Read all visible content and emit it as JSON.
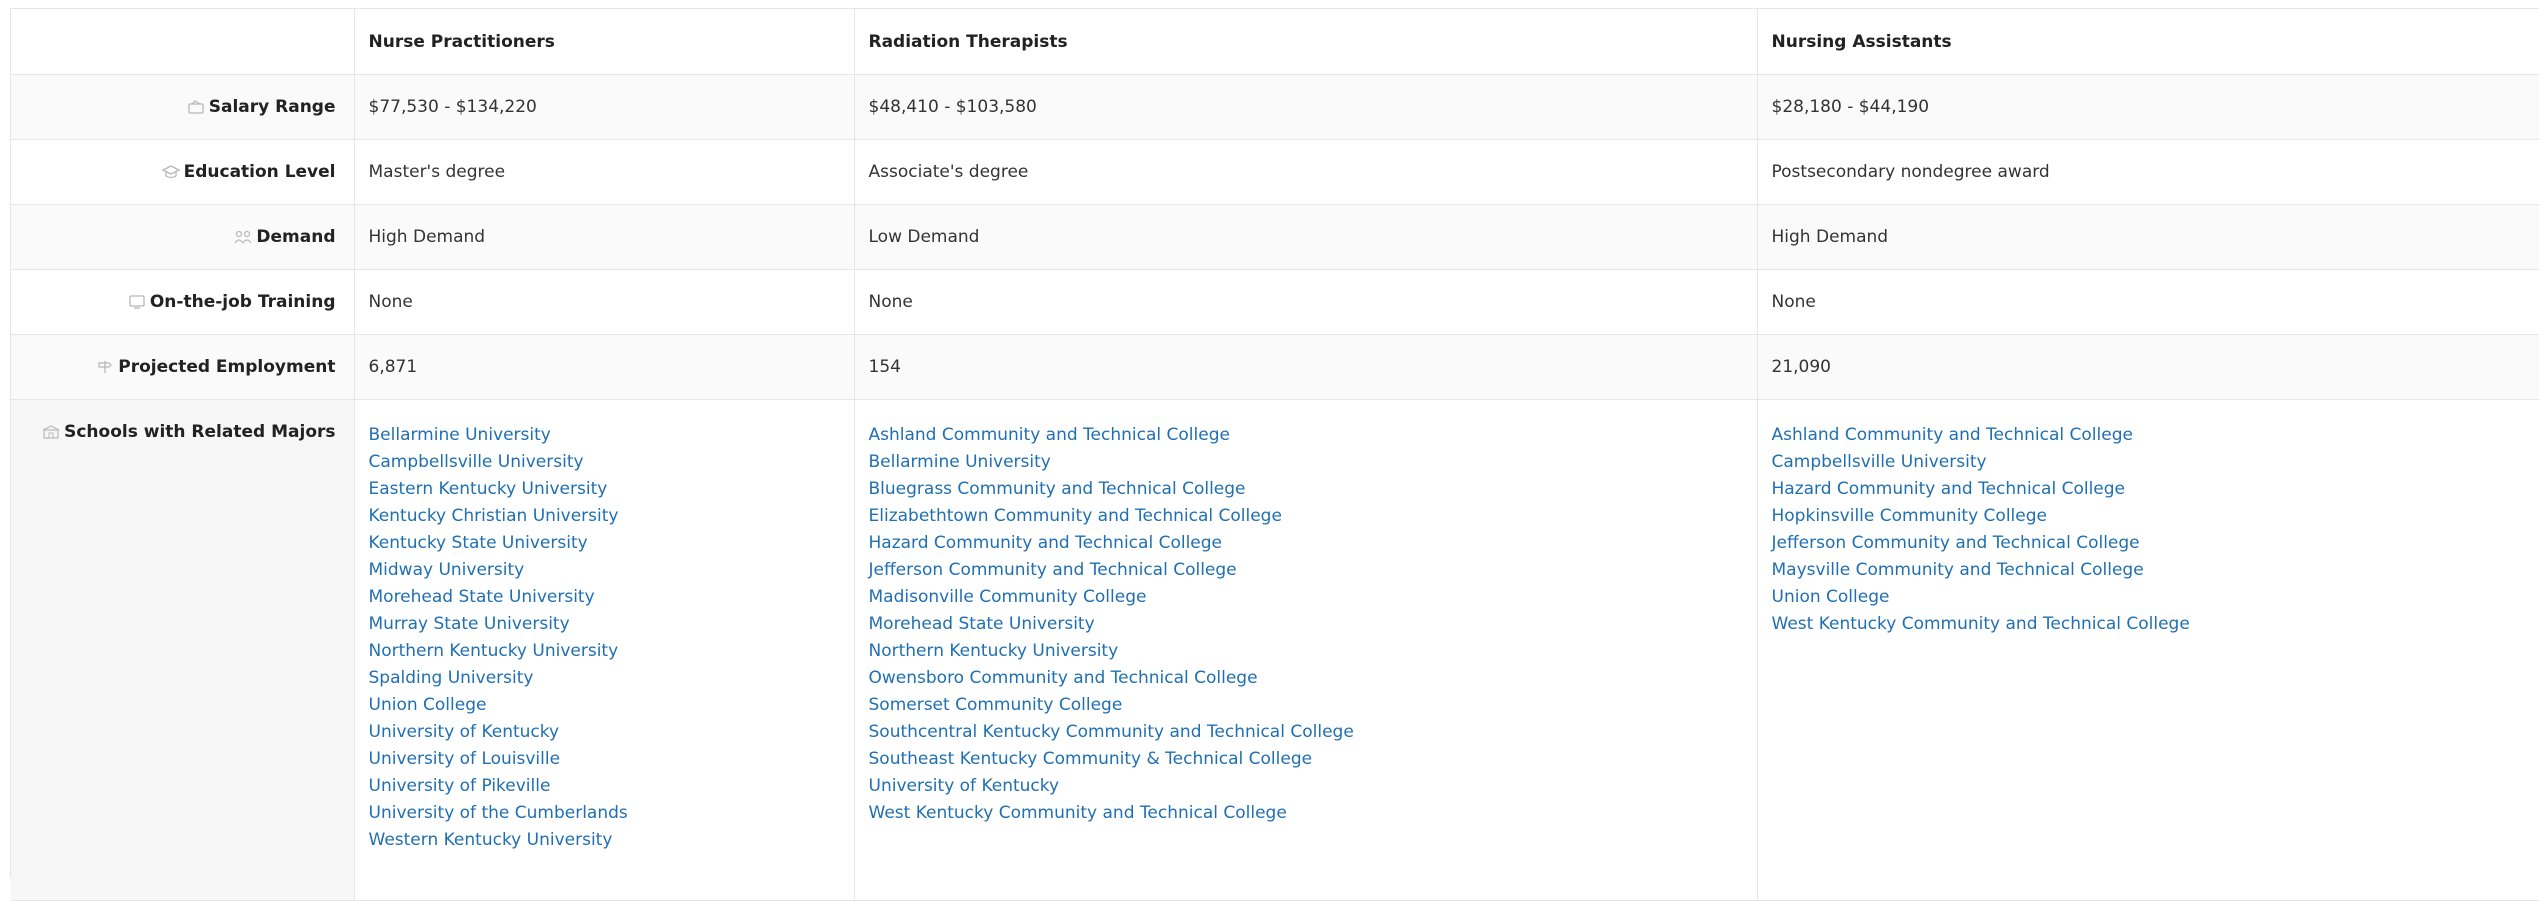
{
  "header": {
    "empty": "",
    "careers": [
      "Nurse Practitioners",
      "Radiation Therapists",
      "Nursing Assistants"
    ]
  },
  "rows": [
    {
      "label": "Salary Range",
      "icon": "salary-icon",
      "values": [
        "$77,530 - $134,220",
        "$48,410 - $103,580",
        "$28,180 - $44,190"
      ]
    },
    {
      "label": "Education Level",
      "icon": "graduation-cap-icon",
      "values": [
        "Master's degree",
        "Associate's degree",
        "Postsecondary nondegree award"
      ]
    },
    {
      "label": "Demand",
      "icon": "people-icon",
      "values": [
        "High Demand",
        "Low Demand",
        "High Demand"
      ]
    },
    {
      "label": "On-the-job Training",
      "icon": "monitor-icon",
      "values": [
        "None",
        "None",
        "None"
      ]
    },
    {
      "label": "Projected Employment",
      "icon": "signpost-icon",
      "values": [
        "6,871",
        "154",
        "21,090"
      ]
    }
  ],
  "schools": {
    "label": "Schools with Related Majors",
    "icon": "school-icon",
    "lists": [
      [
        "Bellarmine University",
        "Campbellsville University",
        "Eastern Kentucky University",
        "Kentucky Christian University",
        "Kentucky State University",
        "Midway University",
        "Morehead State University",
        "Murray State University",
        "Northern Kentucky University",
        "Spalding University",
        "Union College",
        "University of Kentucky",
        "University of Louisville",
        "University of Pikeville",
        "University of the Cumberlands",
        "Western Kentucky University"
      ],
      [
        "Ashland Community and Technical College",
        "Bellarmine University",
        "Bluegrass Community and Technical College",
        "Elizabethtown Community and Technical College",
        "Hazard Community and Technical College",
        "Jefferson Community and Technical College",
        "Madisonville Community College",
        "Morehead State University",
        "Northern Kentucky University",
        "Owensboro Community and Technical College",
        "Somerset Community College",
        "Southcentral Kentucky Community and Technical College",
        "Southeast Kentucky Community & Technical College",
        "University of Kentucky",
        "West Kentucky Community and Technical College"
      ],
      [
        "Ashland Community and Technical College",
        "Campbellsville University",
        "Hazard Community and Technical College",
        "Hopkinsville Community College",
        "Jefferson Community and Technical College",
        "Maysville Community and Technical College",
        "Union College",
        "West Kentucky Community and Technical College"
      ]
    ]
  },
  "colors": {
    "link": "#1f6fb2",
    "border": "#e6e6e6",
    "icon": "#b8b8b8"
  }
}
